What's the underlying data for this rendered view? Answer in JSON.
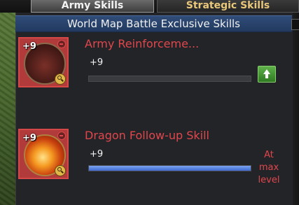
{
  "tabs": [
    {
      "label": "Army Skills",
      "active": true
    },
    {
      "label": "Strategic Skills",
      "active": false
    }
  ],
  "section_header": "World Map Battle Exclusive Skills",
  "skills": [
    {
      "name": "Army Reinforceme...",
      "icon_badge": "+9",
      "level_text": "+9",
      "progress": 0,
      "action": "upgrade",
      "icon": "arrow-up-icon"
    },
    {
      "name": "Dragon Follow-up Skill",
      "icon_badge": "+9",
      "level_text": "+9",
      "progress": 1,
      "max_label": "At max level"
    }
  ],
  "colors": {
    "accent_red": "#e0474d",
    "header_blue": "#2f4c78",
    "progress_blue": "#4f7ae0",
    "upgrade_green": "#3f9a2e"
  }
}
